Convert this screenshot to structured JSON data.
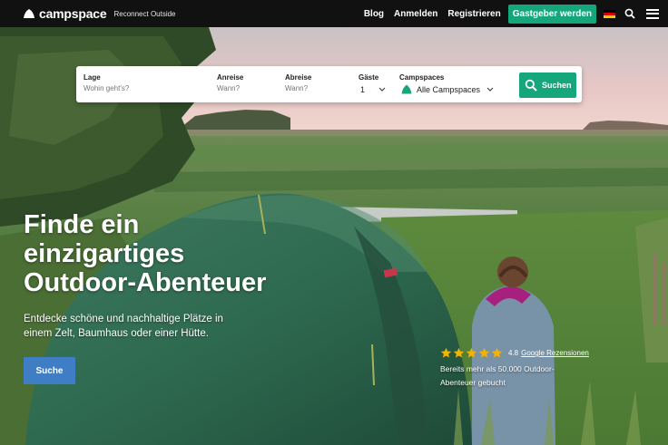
{
  "header": {
    "logo_text": "campspace",
    "tagline": "Reconnect Outside",
    "nav": {
      "blog": "Blog",
      "login": "Anmelden",
      "register": "Registrieren",
      "host": "Gastgeber werden"
    },
    "language_flag": "de-flag-icon",
    "colors": {
      "bar": "#111111",
      "host_button": "#16a67c"
    }
  },
  "search": {
    "location": {
      "label": "Lage",
      "placeholder": "Wohin geht's?"
    },
    "arrival": {
      "label": "Anreise",
      "placeholder": "Wann?"
    },
    "departure": {
      "label": "Abreise",
      "placeholder": "Wann?"
    },
    "guests": {
      "label": "Gäste",
      "value": "1"
    },
    "campspaces": {
      "label": "Campspaces",
      "value": "Alle Campspaces"
    },
    "button_label": "Suchen"
  },
  "hero": {
    "headline": [
      "Finde ein",
      "einzigartiges",
      "Outdoor-Abenteuer"
    ],
    "subline": "Entdecke schöne und nachhaltige Plätze in einem Zelt, Baumhaus oder einer Hütte.",
    "cta_label": "Suche"
  },
  "reviews": {
    "stars": 5,
    "rating": "4.8",
    "link_text": "Google Rezensionen",
    "booked_text": "Bereits mehr als 50.000 Outdoor-Abenteuer gebucht",
    "star_color": "#f5b301"
  }
}
